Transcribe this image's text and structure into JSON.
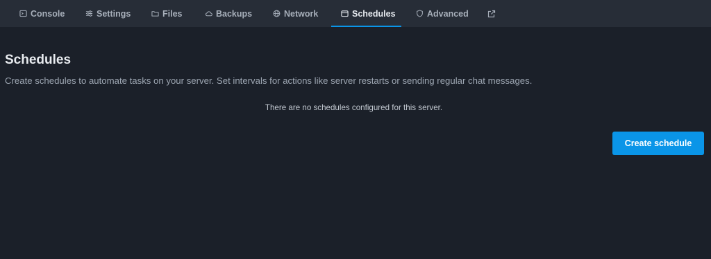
{
  "nav": {
    "tabs": [
      {
        "label": "Console",
        "icon": "terminal-icon"
      },
      {
        "label": "Settings",
        "icon": "sliders-icon"
      },
      {
        "label": "Files",
        "icon": "folder-icon"
      },
      {
        "label": "Backups",
        "icon": "cloud-icon"
      },
      {
        "label": "Network",
        "icon": "globe-icon"
      },
      {
        "label": "Schedules",
        "icon": "calendar-icon",
        "active": true
      },
      {
        "label": "Advanced",
        "icon": "shield-icon"
      }
    ],
    "external_link_icon": "external-link-icon"
  },
  "main": {
    "title": "Schedules",
    "description": "Create schedules to automate tasks on your server. Set intervals for actions like server restarts or sending regular chat messages.",
    "empty_message": "There are no schedules configured for this server.",
    "create_button": "Create schedule"
  },
  "colors": {
    "background": "#1b2029",
    "nav_background": "#272d37",
    "accent": "#0a95e8",
    "nav_text": "#a7afba",
    "title_text": "#e8ebef"
  }
}
